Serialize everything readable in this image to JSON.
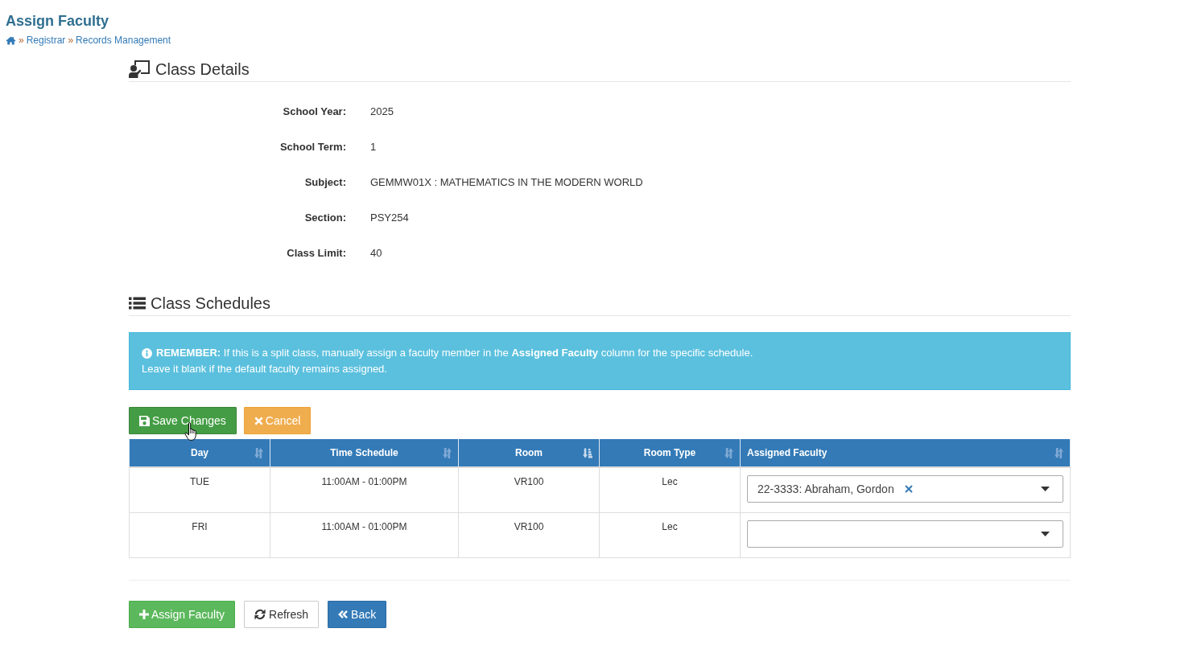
{
  "page": {
    "title": "Assign Faculty",
    "breadcrumb": [
      {
        "kind": "home"
      },
      {
        "kind": "link",
        "separator": "»",
        "label": "Registrar"
      },
      {
        "kind": "link",
        "separator": "»",
        "label": "Records Management"
      }
    ]
  },
  "class_details": {
    "heading": "Class Details",
    "fields": [
      {
        "label": "School Year:",
        "value": "2025"
      },
      {
        "label": "School Term:",
        "value": "1"
      },
      {
        "label": "Subject:",
        "value": "GEMMW01X : MATHEMATICS IN THE MODERN WORLD"
      },
      {
        "label": "Section:",
        "value": "PSY254"
      },
      {
        "label": "Class Limit:",
        "value": "40"
      }
    ]
  },
  "class_schedules": {
    "heading": "Class Schedules",
    "alert": {
      "lines": [
        "**REMEMBER:** If this is a split class, manually assign a faculty member in the **Assigned Faculty** column for the specific schedule.",
        "Leave it blank if the default faculty remains assigned."
      ]
    },
    "toolbar": [
      {
        "kind": "save",
        "label": "Save Changes",
        "hovered": true
      },
      {
        "kind": "cancel",
        "label": "Cancel",
        "hovered": false
      }
    ],
    "table": {
      "columns": [
        {
          "label": "Day",
          "kind": "text",
          "sorted": false
        },
        {
          "label": "Time Schedule",
          "kind": "text",
          "sorted": false
        },
        {
          "label": "Room",
          "kind": "text",
          "sorted": true
        },
        {
          "label": "Room Type",
          "kind": "text",
          "sorted": false
        },
        {
          "label": "Assigned Faculty",
          "kind": "select",
          "sorted": false
        }
      ],
      "rows": [
        {
          "cells": [
            "TUE",
            "11:00AM - 01:00PM",
            "VR100",
            "Lec"
          ],
          "assigned_faculty": {
            "value": "22-3333: Abraham, Gordon",
            "clearable": true
          }
        },
        {
          "cells": [
            "FRI",
            "11:00AM - 01:00PM",
            "VR100",
            "Lec"
          ],
          "assigned_faculty": {
            "clearable": false
          }
        }
      ]
    }
  },
  "actions": [
    {
      "kind": "add",
      "label": "Assign Faculty"
    },
    {
      "kind": "refresh",
      "label": "Refresh"
    },
    {
      "kind": "back",
      "label": "Back"
    }
  ]
}
